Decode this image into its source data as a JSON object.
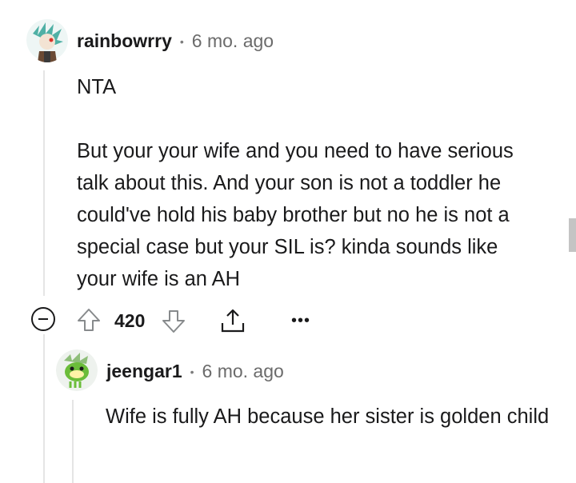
{
  "comment": {
    "username": "rainbowrry",
    "separator": "•",
    "time": "6 mo. ago",
    "paragraphs": [
      "NTA",
      "But your your wife and you need to have serious talk about this. And your son is not a toddler he could've hold his baby brother but no he is not a special case but your SIL is? kinda sounds like your wife is an AH"
    ],
    "votes": "420",
    "more_label": "•••",
    "icons": [
      "collapse-icon",
      "upvote-icon",
      "downvote-icon",
      "share-icon",
      "more-icon"
    ]
  },
  "reply": {
    "username": "jeengar1",
    "separator": "•",
    "time": "6 mo. ago",
    "body": "Wife is fully AH because her sister is golden child"
  },
  "colors": {
    "text": "#1a1a1b",
    "meta": "#6b6b6b",
    "thread_line": "#e5e5e5",
    "avatar_accent": "#4fb0a5",
    "reply_avatar_accent": "#6bbd3a"
  }
}
